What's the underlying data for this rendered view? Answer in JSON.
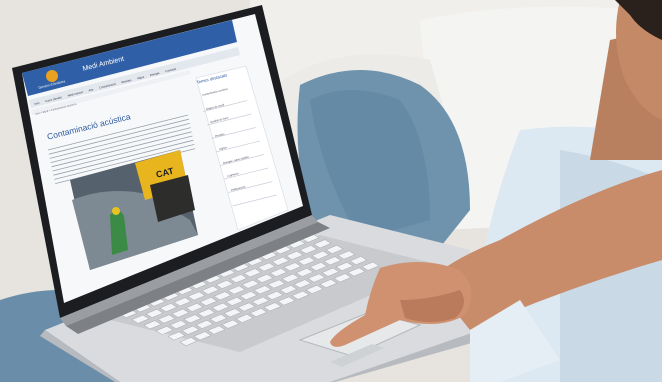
{
  "site": {
    "logo_text": "Govern d'Andorra",
    "header_title": "Medi Ambient",
    "nav_items": [
      "Inici",
      "Canvi climàtic",
      "Medi natural",
      "Aire",
      "Contaminació",
      "Residus",
      "Aigua",
      "Energia",
      "Contacte"
    ],
    "breadcrumb": "Inici > Medi > Contaminació acústica",
    "sidebar_heading": "Temes destacats",
    "sidebar_items": [
      "Contaminació acústica",
      "Mapes de soroll",
      "Qualitat de l'aire",
      "Residus",
      "Aigües",
      "Energia i canvi climàtic",
      "Legislació",
      "Publicacions"
    ],
    "article_title": "Contaminació acústica",
    "photo_machine_text": "CAT"
  },
  "colors": {
    "header_blue": "#2f5fa6",
    "title_blue": "#2c5aa0",
    "page_white": "#f7f8fa",
    "laptop_silver": "#d9dbde",
    "bezel_black": "#1c1d20",
    "jeans": "#6f93ad",
    "skin": "#c98c6a",
    "shirt": "#dde9f2",
    "cat_yellow": "#e8b51f"
  }
}
